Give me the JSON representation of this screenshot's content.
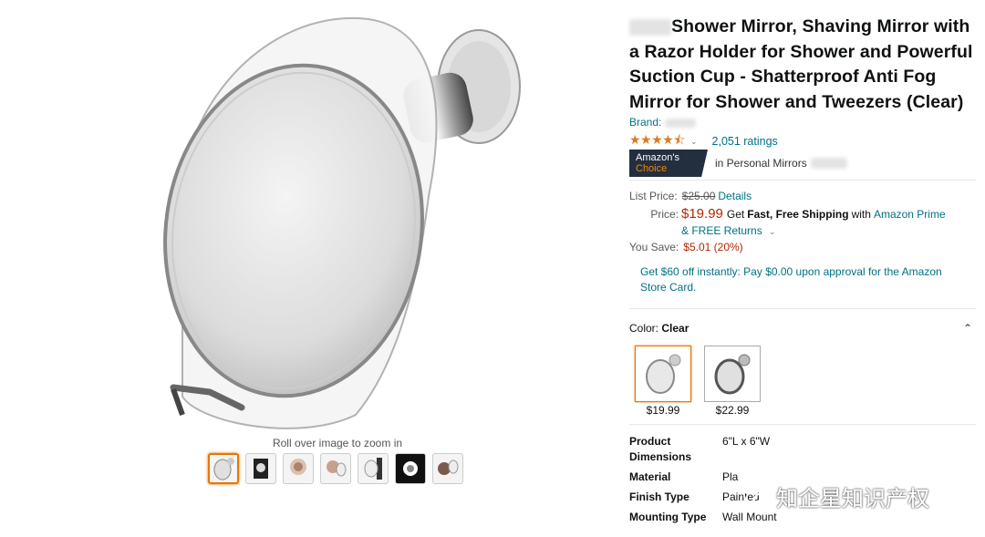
{
  "gallery": {
    "zoom_hint": "Roll over image to zoom in",
    "thumbnails": [
      "mirror-front",
      "mirror-box",
      "mirror-woman",
      "mirror-man",
      "mirror-wall",
      "mirror-black",
      "mirror-man-shaving"
    ]
  },
  "product": {
    "title": "Shower Mirror, Shaving Mirror with a Razor Holder for Shower and Powerful Suction Cup - Shatterproof Anti Fog Mirror for Shower and Tweezers (Clear)",
    "brand_label": "Brand:",
    "rating_stars": "★★★★⯪",
    "ratings_count": "2,051 ratings",
    "badge_prefix": "Amazon's",
    "badge_suffix": "Choice",
    "badge_category": "in Personal Mirrors"
  },
  "price": {
    "list_label": "List Price:",
    "list_value": "$25.00",
    "details_link": "Details",
    "price_label": "Price:",
    "price_value": "$19.99",
    "shipping_pre": "Get",
    "shipping_bold": "Fast, Free Shipping",
    "shipping_with": "with",
    "prime_link": "Amazon Prime",
    "returns_link": "& FREE Returns",
    "save_label": "You Save:",
    "save_value": "$5.01 (20%)",
    "card_offer": "Get $60 off instantly: Pay $0.00 upon approval for the Amazon Store Card."
  },
  "color": {
    "label": "Color:",
    "selected": "Clear",
    "options": [
      {
        "price": "$19.99"
      },
      {
        "price": "$22.99"
      }
    ]
  },
  "specs": [
    {
      "k": "Product Dimensions",
      "v": "6\"L x 6\"W"
    },
    {
      "k": "Material",
      "v": "Pla"
    },
    {
      "k": "Finish Type",
      "v": "Painted"
    },
    {
      "k": "Mounting Type",
      "v": "Wall Mount"
    }
  ],
  "watermark": "知企星知识产权",
  "colors": {
    "link": "#007185",
    "price": "#b12704",
    "star": "#de7921",
    "badge_bg": "#232f3e"
  }
}
